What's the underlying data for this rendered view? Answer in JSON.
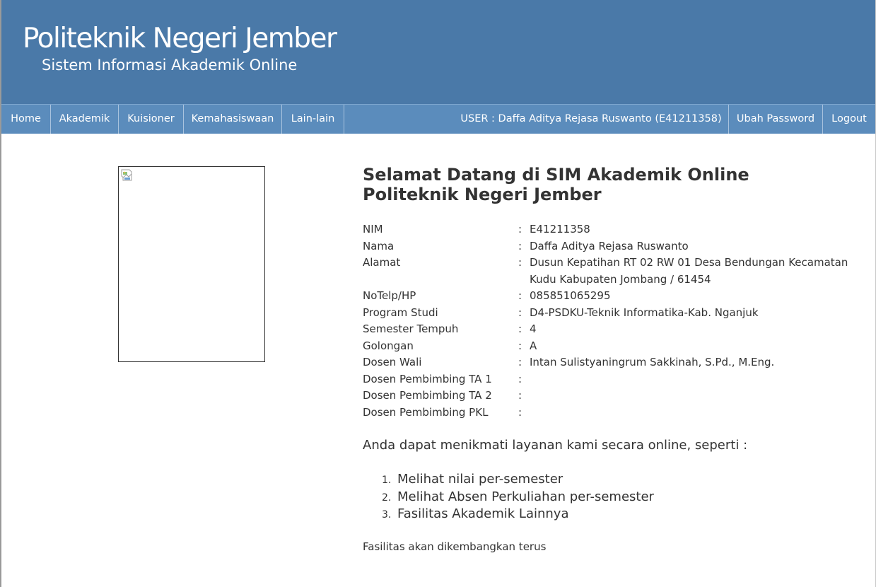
{
  "header": {
    "title": "Politeknik Negeri Jember",
    "subtitle": "Sistem Informasi Akademik Online"
  },
  "nav": {
    "home": "Home",
    "akademik": "Akademik",
    "kuisioner": "Kuisioner",
    "kemahasiswaan": "Kemahasiswaan",
    "lain_lain": "Lain-lain",
    "user": "USER : Daffa Aditya Rejasa Ruswanto (E41211358)",
    "ubah_password": "Ubah Password",
    "logout": "Logout"
  },
  "welcome": {
    "line1": "Selamat Datang di SIM Akademik Online",
    "line2": "Politeknik Negeri Jember"
  },
  "colon": ":",
  "profile": [
    {
      "label": "NIM",
      "value": "E41211358"
    },
    {
      "label": "Nama",
      "value": "Daffa Aditya Rejasa Ruswanto"
    },
    {
      "label": "Alamat",
      "value": "Dusun Kepatihan RT 02 RW 01 Desa Bendungan Kecamatan Kudu Kabupaten Jombang / 61454"
    },
    {
      "label": "NoTelp/HP",
      "value": "085851065295"
    },
    {
      "label": "Program Studi",
      "value": "D4-PSDKU-Teknik Informatika-Kab. Nganjuk"
    },
    {
      "label": "Semester Tempuh",
      "value": "4"
    },
    {
      "label": "Golongan",
      "value": "A"
    },
    {
      "label": "Dosen Wali",
      "value": "Intan Sulistyaningrum Sakkinah, S.Pd., M.Eng."
    },
    {
      "label": "Dosen Pembimbing TA 1",
      "value": ""
    },
    {
      "label": "Dosen Pembimbing TA 2",
      "value": ""
    },
    {
      "label": "Dosen Pembimbing PKL",
      "value": ""
    }
  ],
  "services": {
    "intro": "Anda dapat menikmati layanan kami secara online, seperti :",
    "items": [
      {
        "num": "1.",
        "text": "Melihat nilai per-semester"
      },
      {
        "num": "2.",
        "text": "Melihat Absen Perkuliahan per-semester"
      },
      {
        "num": "3.",
        "text": "Fasilitas Akademik Lainnya"
      }
    ]
  },
  "footer_note": "Fasilitas akan dikembangkan terus",
  "colors": {
    "header_bg": "#4a79a8",
    "navbar_bg": "#5b8cbc",
    "text": "#333333"
  }
}
